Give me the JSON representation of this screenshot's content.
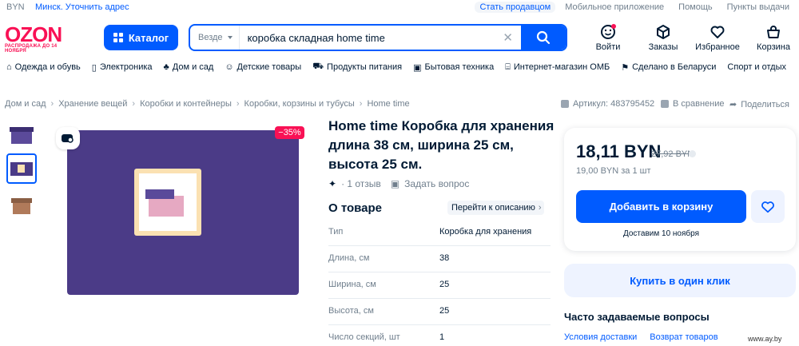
{
  "topbar": {
    "currency": "BYN",
    "city": "Минск. Уточнить адрес",
    "links": [
      "Стать продавцом",
      "Мобильное приложение",
      "Помощь",
      "Пункты выдачи"
    ]
  },
  "header": {
    "logo": "OZON",
    "logo_sub": "РАСПРОДАЖА ДО 14 НОЯБРЯ",
    "catalog_label": "Каталог",
    "search_scope": "Везде",
    "search_value": "коробка складная home time",
    "actions": {
      "login": "Войти",
      "orders": "Заказы",
      "favorites": "Избранное",
      "cart": "Корзина"
    }
  },
  "nav": [
    {
      "label": "Одежда и обувь",
      "icon": "hanger-icon"
    },
    {
      "label": "Электроника",
      "icon": "phone-icon"
    },
    {
      "label": "Дом и сад",
      "icon": "plant-icon"
    },
    {
      "label": "Детские товары",
      "icon": "baby-icon"
    },
    {
      "label": "Продукты питания",
      "icon": "cart-icon"
    },
    {
      "label": "Бытовая техника",
      "icon": "appliance-icon"
    },
    {
      "label": "Интернет-магазин ОМБ",
      "icon": "store-icon"
    },
    {
      "label": "Сделано в Беларуси",
      "icon": "flag-icon"
    },
    {
      "label": "Спорт и отдых",
      "icon": ""
    }
  ],
  "breadcrumbs": [
    "Дом и сад",
    "Хранение вещей",
    "Коробки и контейнеры",
    "Коробки, корзины и тубусы",
    "Home time"
  ],
  "meta": {
    "article": "Артикул: 483795452",
    "compare": "В сравнение",
    "share": "Поделиться"
  },
  "product": {
    "discount": "−35%",
    "title": "Home time Коробка для хранения длина 38 см, ширина 25 см, высота 25 см.",
    "reviews": "· 1 отзыв",
    "ask": "Задать вопрос",
    "about_title": "О товаре",
    "to_description": "Перейти к описанию",
    "specs": [
      {
        "key": "Тип",
        "value": "Коробка для хранения"
      },
      {
        "key": "Длина, см",
        "value": "38"
      },
      {
        "key": "Ширина, см",
        "value": "25"
      },
      {
        "key": "Высота, см",
        "value": "25"
      },
      {
        "key": "Число секций, шт",
        "value": "1"
      }
    ]
  },
  "price_card": {
    "price": "18,11 BYN",
    "old_price": "27,92 BYN",
    "unit_price": "19,00 BYN за 1 шт",
    "add_to_cart": "Добавить в корзину",
    "delivery": "Доставим 10 ноября",
    "buy_one_click": "Купить в один клик"
  },
  "faq": {
    "title": "Часто задаваемые вопросы",
    "links": [
      "Условия доставки",
      "Возврат товаров"
    ]
  },
  "watermark": "www.ay.by",
  "colors": {
    "brand_blue": "#005bff",
    "brand_pink": "#f91155",
    "product_purple": "#4b3b87"
  }
}
